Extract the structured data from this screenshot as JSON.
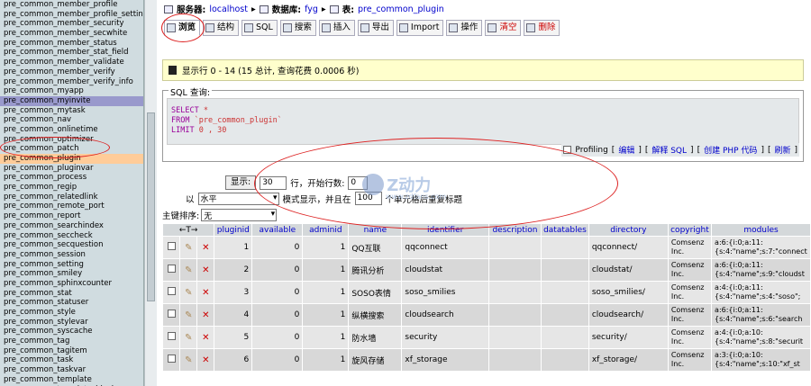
{
  "sidebar": {
    "items": [
      "pre_common_member_profile",
      "pre_common_member_profile_settinc",
      "pre_common_member_security",
      "pre_common_member_secwhite",
      "pre_common_member_status",
      "pre_common_member_stat_field",
      "pre_common_member_validate",
      "pre_common_member_verify",
      "pre_common_member_verify_info",
      "pre_common_myapp",
      "pre_common_myinvite",
      "pre_common_mytask",
      "pre_common_nav",
      "pre_common_onlinetime",
      "pre_common_optimizer",
      "pre_common_patch",
      "pre_common_plugin",
      "pre_common_pluginvar",
      "pre_common_process",
      "pre_common_regip",
      "pre_common_relatedlink",
      "pre_common_remote_port",
      "pre_common_report",
      "pre_common_searchindex",
      "pre_common_seccheck",
      "pre_common_secquestion",
      "pre_common_session",
      "pre_common_setting",
      "pre_common_smiley",
      "pre_common_sphinxcounter",
      "pre_common_stat",
      "pre_common_statuser",
      "pre_common_style",
      "pre_common_stylevar",
      "pre_common_syscache",
      "pre_common_tag",
      "pre_common_tagitem",
      "pre_common_task",
      "pre_common_taskvar",
      "pre_common_template",
      "pre_common_template_block"
    ],
    "active_index": 10,
    "selected_index": 16
  },
  "crumb": {
    "server_label": "服务器:",
    "server_value": "localhost",
    "db_label": "数据库:",
    "db_value": "fyg",
    "table_label": "表:",
    "table_value": "pre_common_plugin"
  },
  "tabs": [
    "浏览",
    "结构",
    "SQL",
    "搜索",
    "插入",
    "导出",
    "Import",
    "操作",
    "清空",
    "删除"
  ],
  "notice": {
    "text": "显示行 0 - 14 (15 总计, 查询花费 0.0006 秒)"
  },
  "sql": {
    "legend": "SQL 查询:",
    "line1_kw": "SELECT",
    "line1_rest": " *",
    "line2_kw": "FROM",
    "line2_rest": " `pre_common_plugin`",
    "line3_kw": "LIMIT",
    "line3_rest": " 0 , 30",
    "profiling": "Profiling",
    "edit": "编辑",
    "explain": "解释 SQL",
    "create_php": "创建 PHP 代码",
    "refresh": "刷新"
  },
  "form": {
    "show_button": "显示:",
    "rows_value": "30",
    "rows_label": "行，开始行数:",
    "start_value": "0",
    "mode_prefix": "以",
    "mode_value": "水平",
    "mode_mid": "模式显示，并且在",
    "repeat_value": "100",
    "repeat_suffix": "个单元格后重复标题",
    "sort_label": "主键排序:",
    "sort_value": "无"
  },
  "table": {
    "columns": [
      "pluginid",
      "available",
      "adminid",
      "name",
      "identifier",
      "description",
      "datatables",
      "directory",
      "copyright",
      "modules"
    ],
    "rows": [
      [
        "1",
        "0",
        "1",
        "QQ互联",
        "qqconnect",
        "",
        "",
        "qqconnect/",
        "Comsenz Inc.",
        "a:6:{i:0;a:11:{s:4:\"name\";s:7:\"connect"
      ],
      [
        "2",
        "0",
        "1",
        "腾讯分析",
        "cloudstat",
        "",
        "",
        "cloudstat/",
        "Comsenz Inc.",
        "a:6:{i:0;a:11:{s:4:\"name\";s:9:\"cloudst"
      ],
      [
        "3",
        "0",
        "1",
        "SOSO表情",
        "soso_smilies",
        "",
        "",
        "soso_smilies/",
        "Comsenz Inc.",
        "a:4:{i:0;a:11:{s:4:\"name\";s:4:\"soso\";"
      ],
      [
        "4",
        "0",
        "1",
        "纵横搜索",
        "cloudsearch",
        "",
        "",
        "cloudsearch/",
        "Comsenz Inc.",
        "a:6:{i:0;a:11:{s:4:\"name\";s:6:\"search"
      ],
      [
        "5",
        "0",
        "1",
        "防水墙",
        "security",
        "",
        "",
        "security/",
        "Comsenz Inc.",
        "a:4:{i:0;a:10:{s:4:\"name\";s:8:\"securit"
      ],
      [
        "6",
        "0",
        "1",
        "旋风存储",
        "xf_storage",
        "",
        "",
        "xf_storage/",
        "Comsenz Inc.",
        "a:3:{i:0;a:10:{s:4:\"name\";s:10:\"xf_st"
      ]
    ]
  },
  "watermark": {
    "title": "Z动力",
    "url": "www.zdfans.com"
  },
  "colors": {
    "sidebar_bg": "#d0dce0",
    "active_row": "#9999cc",
    "selected_row": "#ffcc99",
    "annotation": "#dd2222",
    "notice_bg": "#ffffcc"
  }
}
